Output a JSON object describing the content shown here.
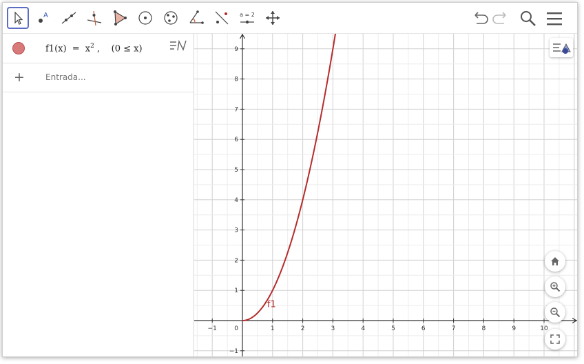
{
  "toolbar": {
    "tools": [
      {
        "name": "move"
      },
      {
        "name": "point"
      },
      {
        "name": "line"
      },
      {
        "name": "perpendicular"
      },
      {
        "name": "polygon"
      },
      {
        "name": "circle-center-point"
      },
      {
        "name": "circle-three-points"
      },
      {
        "name": "angle"
      },
      {
        "name": "reflect"
      },
      {
        "name": "slider",
        "label": "a = 2"
      },
      {
        "name": "move-graphics"
      }
    ],
    "right": [
      "undo-icon",
      "redo-icon",
      "search-icon",
      "menu-icon"
    ]
  },
  "algebra": {
    "f1": {
      "name": "f1(x)",
      "eq": "=",
      "rhs": "x",
      "sup": "2",
      "cond": ",    (0 ≤ x)",
      "color": "#d97a7a"
    },
    "input_placeholder": "Entrada..."
  },
  "graph": {
    "x_ticks": [
      "−1",
      "1",
      "2",
      "3",
      "4",
      "5",
      "6",
      "7",
      "8",
      "9",
      "10"
    ],
    "y_ticks": [
      "9",
      "8",
      "7",
      "6",
      "5",
      "4",
      "3",
      "2",
      "1",
      "−1"
    ],
    "origin_label": "0",
    "function_label": "f1",
    "function_color": "#b52c2c",
    "x_range": [
      -1.5,
      11
    ],
    "y_range": [
      -1.5,
      9.5
    ]
  }
}
